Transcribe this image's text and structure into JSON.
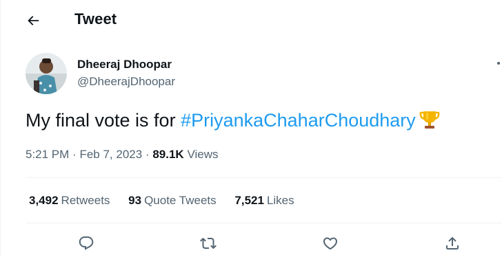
{
  "header": {
    "title": "Tweet",
    "back_icon": "arrow-left-icon"
  },
  "author": {
    "name": "Dheeraj Dhoopar",
    "handle": "@DheerajDhoopar"
  },
  "tweet": {
    "text_prefix": "My final vote is for ",
    "hashtag": "#PriyankaChaharChoudhary",
    "emoji_icon": "trophy-icon"
  },
  "meta": {
    "time": "5:21 PM",
    "separator": "·",
    "date": "Feb 7, 2023",
    "views_count": "89.1K",
    "views_label": "Views"
  },
  "stats": {
    "retweets_count": "3,492",
    "retweets_label": "Retweets",
    "quotes_count": "93",
    "quotes_label": "Quote Tweets",
    "likes_count": "7,521",
    "likes_label": "Likes"
  },
  "actions": [
    "reply-icon",
    "retweet-icon",
    "like-icon",
    "share-icon"
  ],
  "colors": {
    "accent": "#1d9bf0",
    "text": "#0f1419",
    "muted": "#536471",
    "divider": "#eff3f4"
  }
}
